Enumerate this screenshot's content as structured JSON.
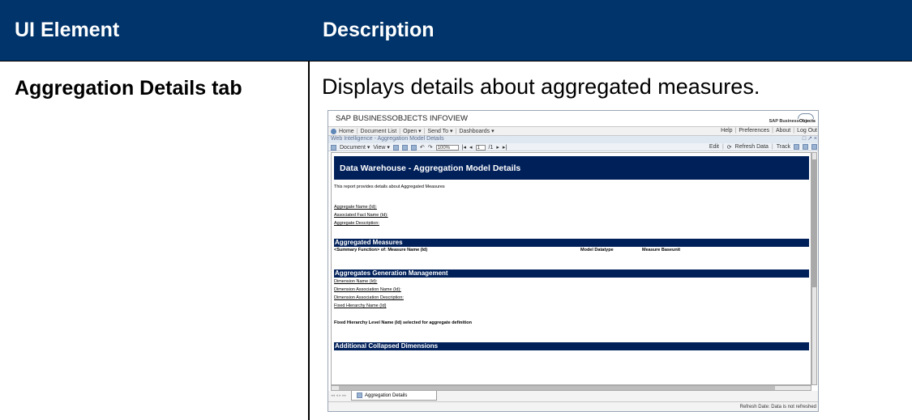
{
  "table": {
    "header": {
      "col1": "UI Element",
      "col2": "Description"
    },
    "row": {
      "element": "Aggregation Details  tab",
      "description": "Displays details about aggregated measures."
    }
  },
  "screenshot": {
    "app_title": "SAP BUSINESSOBJECTS INFOVIEW",
    "logo_text_a": "SAP Business",
    "logo_text_b": "Objects",
    "nav_left": [
      "Home",
      "Document List",
      "Open ▾",
      "Send To ▾",
      "Dashboards ▾"
    ],
    "nav_right": [
      "Help",
      "Preferences",
      "About",
      "Log Out"
    ],
    "doc_title": "Web Intelligence - Aggregation Model Details",
    "window_controls": "□ ↗ ×",
    "toolbar": {
      "document": "Document ▾",
      "view": "View ▾",
      "zoom": "100%",
      "page": "1",
      "page_of": "/1",
      "edit": "Edit",
      "refresh": "Refresh Data",
      "track": "Track"
    },
    "report": {
      "title": "Data Warehouse - Aggregation  Model Details",
      "intro": "This report provides details about Aggregated Measures",
      "fields": [
        "Aggregate Name (Id):",
        "Associated Fact Name (Id):",
        "Aggregate Description:"
      ],
      "section1": "Aggregated Measures",
      "section1_cols": [
        "<Summary Function> of: Measure Name (Id)",
        "Model Datatype",
        "Measure Baseunit"
      ],
      "section2": "Aggregates Generation Management",
      "dim_fields": [
        "Dimension Name (Id):",
        "Dimension Association Name (Id):",
        "Dimension Association Description:",
        "Fixed Hierarchy Name (Id)"
      ],
      "level_text": "Fixed Hierarchy Level Name (Id) selected for aggregate definition",
      "section3": "Additional Collapsed Dimensions"
    },
    "report_tab": "Aggregation Details",
    "status": "Refresh Date: Data is not refreshed"
  }
}
